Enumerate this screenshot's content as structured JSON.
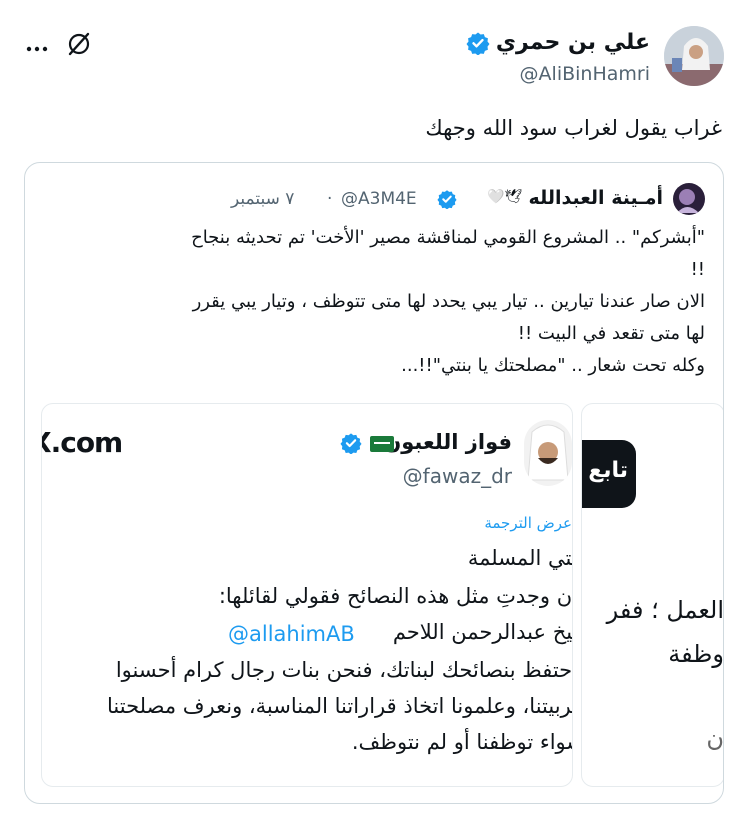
{
  "tweet": {
    "author_name": "علي بن حمري",
    "author_handle": "@AliBinHamri",
    "text": "غراب يقول لغراب سود الله وجهك",
    "verified_color": "#1d9bf0"
  },
  "quoted": {
    "author_name": "أمـينة العبدالله",
    "emoji_suffix": "🤍🕊",
    "handle": "@A3M4E",
    "separator": "·",
    "date": "٧ سبتمبر",
    "lines": [
      "\"أبشركم\" .. المشروع القومي لمناقشة  مصير 'الأخت' تم تحديثه بنجاح",
      "!!",
      "الان صار عندنا تيارين .. تيار يبي يحدد لها متى تتوظف ، وتيار يبي يقرر",
      "لها متى تقعد في البيت !!",
      "وكله تحت شعار .. \"مصلحتك يا بنتي\"!!..."
    ]
  },
  "image_card": {
    "author_name": "فواز اللعبون",
    "flag": "🇸🇦",
    "handle": "@fawaz_dr",
    "corner_text": "X.com",
    "translate_label": "عرض الترجمة",
    "lines": [
      "بنتي المسلمة",
      "إن وجدتِ مثل هذه النصائح فقولي لقائلها:",
      "أيها الشيخ عبدالرحمن اللاحم",
      "احتفظ بنصائحك لبناتك، فنحن بنات رجال كرام أحسنوا",
      "تربيتنا، وعلمونا اتخاذ قراراتنا المناسبة، ونعرف مصلحتنا",
      "سواء توظفنا أو لم نتوظف."
    ],
    "mention": "@allahimAB"
  },
  "second_card": {
    "button_label": "تابع",
    "lines": [
      "العمل ؛ ففر",
      "وظفة",
      "ن"
    ]
  },
  "icons": {
    "more": "more-icon",
    "grok": "grok-icon",
    "verified": "verified-badge-icon"
  }
}
